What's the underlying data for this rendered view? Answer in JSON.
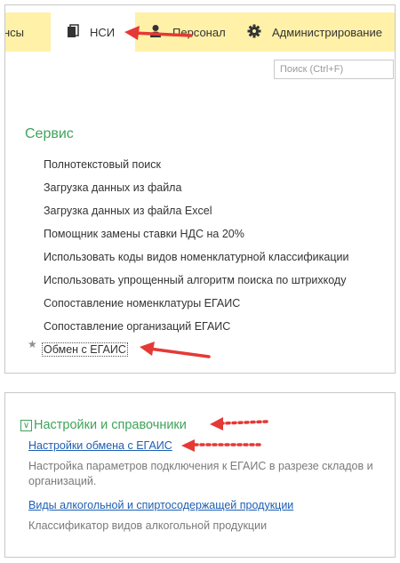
{
  "tabs": {
    "prev_label": "нсы",
    "nsi_label": "НСИ",
    "personnel_label": "Персонал",
    "admin_label": "Администрирование"
  },
  "search": {
    "placeholder": "Поиск (Ctrl+F)"
  },
  "service": {
    "title": "Сервис",
    "items": [
      "Полнотекстовый поиск",
      "Загрузка данных из файла",
      "Загрузка данных из файла Excel",
      "Помощник замены ставки НДС на 20%",
      "Использовать коды видов номенклатурной классификации",
      "Использовать упрощенный алгоритм поиска по штрихкоду",
      "Сопоставление номенклатуры ЕГАИС",
      "Сопоставление организаций ЕГАИС",
      "Обмен с ЕГАИС"
    ]
  },
  "settings": {
    "title": "Настройки и справочники",
    "link1": "Настройки обмена с ЕГАИС",
    "desc1": "Настройка параметров подключения к ЕГАИС в разрезе складов и организаций.",
    "link2": "Виды алкогольной и спиртосодержащей продукции",
    "desc2": "Классификатор видов алкогольной продукции"
  },
  "colors": {
    "accent_green": "#3fa35b",
    "tab_bar": "#fff1a8",
    "link_blue": "#1d5fb3",
    "arrow_red": "#e53935"
  }
}
